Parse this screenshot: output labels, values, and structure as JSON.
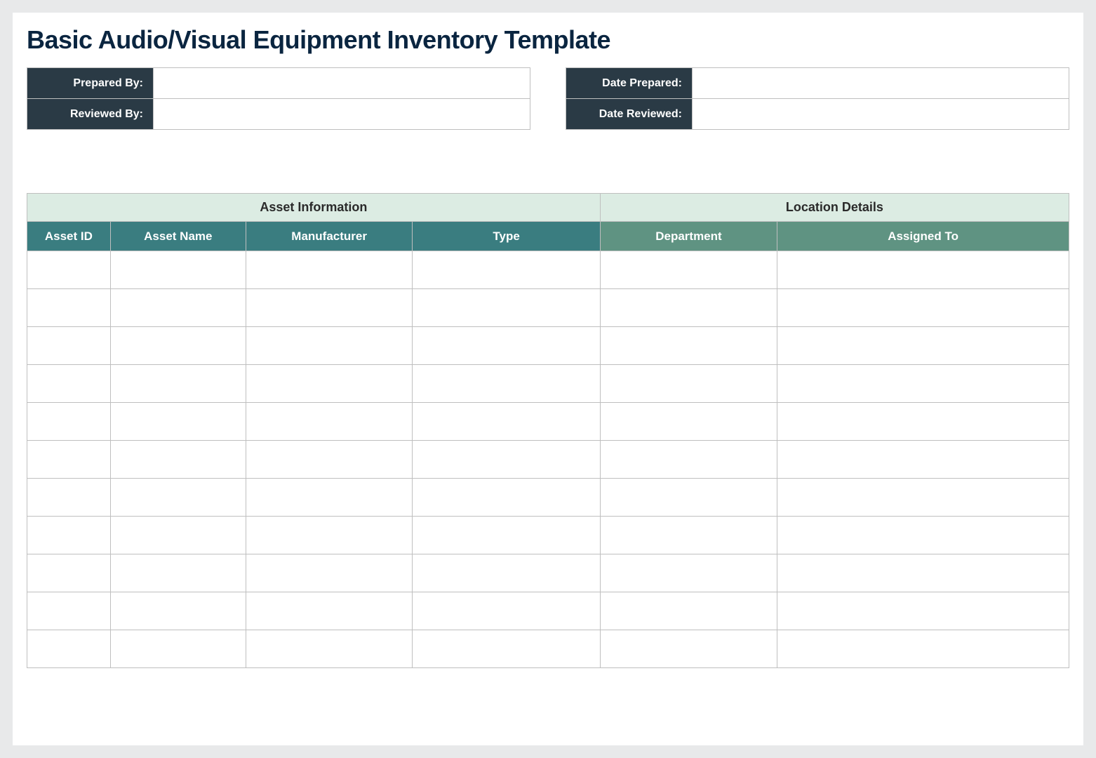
{
  "title": "Basic Audio/Visual Equipment Inventory Template",
  "meta": {
    "prepared_by_label": "Prepared By:",
    "prepared_by_value": "",
    "reviewed_by_label": "Reviewed By:",
    "reviewed_by_value": "",
    "date_prepared_label": "Date Prepared:",
    "date_prepared_value": "",
    "date_reviewed_label": "Date Reviewed:",
    "date_reviewed_value": ""
  },
  "groups": {
    "asset_info": "Asset Information",
    "location_details": "Location Details"
  },
  "columns": {
    "asset_id": "Asset ID",
    "asset_name": "Asset Name",
    "manufacturer": "Manufacturer",
    "type": "Type",
    "department": "Department",
    "assigned_to": "Assigned To"
  },
  "rows": [
    {
      "asset_id": "",
      "asset_name": "",
      "manufacturer": "",
      "type": "",
      "department": "",
      "assigned_to": ""
    },
    {
      "asset_id": "",
      "asset_name": "",
      "manufacturer": "",
      "type": "",
      "department": "",
      "assigned_to": ""
    },
    {
      "asset_id": "",
      "asset_name": "",
      "manufacturer": "",
      "type": "",
      "department": "",
      "assigned_to": ""
    },
    {
      "asset_id": "",
      "asset_name": "",
      "manufacturer": "",
      "type": "",
      "department": "",
      "assigned_to": ""
    },
    {
      "asset_id": "",
      "asset_name": "",
      "manufacturer": "",
      "type": "",
      "department": "",
      "assigned_to": ""
    },
    {
      "asset_id": "",
      "asset_name": "",
      "manufacturer": "",
      "type": "",
      "department": "",
      "assigned_to": ""
    },
    {
      "asset_id": "",
      "asset_name": "",
      "manufacturer": "",
      "type": "",
      "department": "",
      "assigned_to": ""
    },
    {
      "asset_id": "",
      "asset_name": "",
      "manufacturer": "",
      "type": "",
      "department": "",
      "assigned_to": ""
    },
    {
      "asset_id": "",
      "asset_name": "",
      "manufacturer": "",
      "type": "",
      "department": "",
      "assigned_to": ""
    },
    {
      "asset_id": "",
      "asset_name": "",
      "manufacturer": "",
      "type": "",
      "department": "",
      "assigned_to": ""
    },
    {
      "asset_id": "",
      "asset_name": "",
      "manufacturer": "",
      "type": "",
      "department": "",
      "assigned_to": ""
    }
  ]
}
